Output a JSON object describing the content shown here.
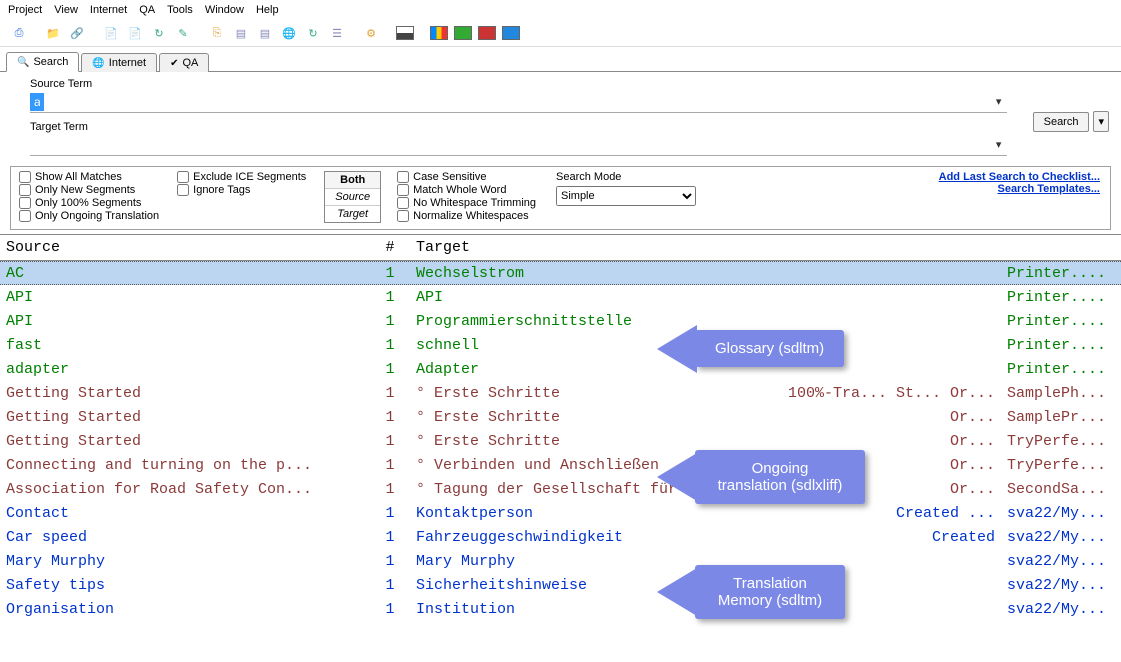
{
  "menubar": [
    "Project",
    "View",
    "Internet",
    "QA",
    "Tools",
    "Window",
    "Help"
  ],
  "tabs": [
    {
      "icon": "search-icon",
      "label": "Search",
      "active": true
    },
    {
      "icon": "globe-icon",
      "label": "Internet",
      "active": false
    },
    {
      "icon": "check-icon",
      "label": "QA",
      "active": false
    }
  ],
  "search": {
    "source_label": "Source Term",
    "source_value": "a",
    "target_label": "Target Term",
    "target_value": "",
    "button": "Search"
  },
  "options_left": [
    "Show All Matches",
    "Only New Segments",
    "Only 100% Segments",
    "Only Ongoing Translation"
  ],
  "options_mid": [
    "Exclude ICE Segments",
    "Ignore Tags"
  ],
  "both_box": {
    "header": "Both",
    "r1": "Source",
    "r2": "Target"
  },
  "options_right": [
    "Case Sensitive",
    "Match Whole Word",
    "No Whitespace Trimming",
    "Normalize Whitespaces"
  ],
  "search_mode": {
    "label": "Search Mode",
    "value": "Simple"
  },
  "links": [
    "Add Last Search to Checklist...",
    "Search Templates..."
  ],
  "grid": {
    "headers": {
      "source": "Source",
      "num": "#",
      "target": "Target"
    },
    "rows": [
      {
        "src": "AC",
        "num": "1",
        "tgt": "Wechselstrom",
        "file": "Printer....",
        "cls": "c-green",
        "sel": true
      },
      {
        "src": "API",
        "num": "1",
        "tgt": "API",
        "file": "Printer....",
        "cls": "c-green"
      },
      {
        "src": "API",
        "num": "1",
        "tgt": "Programmierschnittstelle",
        "file": "Printer....",
        "cls": "c-green"
      },
      {
        "src": "fast",
        "num": "1",
        "tgt": "schnell",
        "file": "Printer....",
        "cls": "c-green"
      },
      {
        "src": "adapter",
        "num": "1",
        "tgt": "Adapter",
        "file": "Printer....",
        "cls": "c-green"
      },
      {
        "src": "Getting Started",
        "num": "1",
        "tgt": "° Erste Schritte",
        "file": "SamplePh...",
        "cls": "c-brown",
        "extra": "100%-Tra... St... Or..."
      },
      {
        "src": "Getting Started",
        "num": "1",
        "tgt": "° Erste Schritte",
        "file": "SamplePr...",
        "cls": "c-brown",
        "extra": "Or..."
      },
      {
        "src": "Getting Started",
        "num": "1",
        "tgt": "° Erste Schritte",
        "file": "TryPerfe...",
        "cls": "c-brown",
        "extra": "Or..."
      },
      {
        "src": "Connecting and turning on the p...",
        "num": "1",
        "tgt": "° Verbinden und Anschließen",
        "file": "TryPerfe...",
        "cls": "c-brown",
        "extra": "Or..."
      },
      {
        "src": "Association for Road Safety Con...",
        "num": "1",
        "tgt": "° Tagung der Gesellschaft für V...",
        "file": "SecondSa...",
        "cls": "c-brown",
        "extra": "Or..."
      },
      {
        "src": "Contact",
        "num": "1",
        "tgt": "Kontaktperson",
        "file": "sva22/My...",
        "cls": "c-blue",
        "extra": "Created ..."
      },
      {
        "src": "Car speed",
        "num": "1",
        "tgt": "Fahrzeuggeschwindigkeit",
        "file": "sva22/My...",
        "cls": "c-blue",
        "extra": "Created"
      },
      {
        "src": "Mary Murphy",
        "num": "1",
        "tgt": "Mary Murphy",
        "file": "sva22/My...",
        "cls": "c-blue"
      },
      {
        "src": "Safety tips",
        "num": "1",
        "tgt": "Sicherheitshinweise",
        "file": "sva22/My...",
        "cls": "c-blue"
      },
      {
        "src": "Organisation",
        "num": "1",
        "tgt": "Institution",
        "file": "sva22/My...",
        "cls": "c-blue"
      }
    ]
  },
  "callouts": {
    "c1": "Glossary (sdltm)",
    "c2": "Ongoing translation (sdlxliff)",
    "c3": "Translation Memory (sdltm)"
  }
}
